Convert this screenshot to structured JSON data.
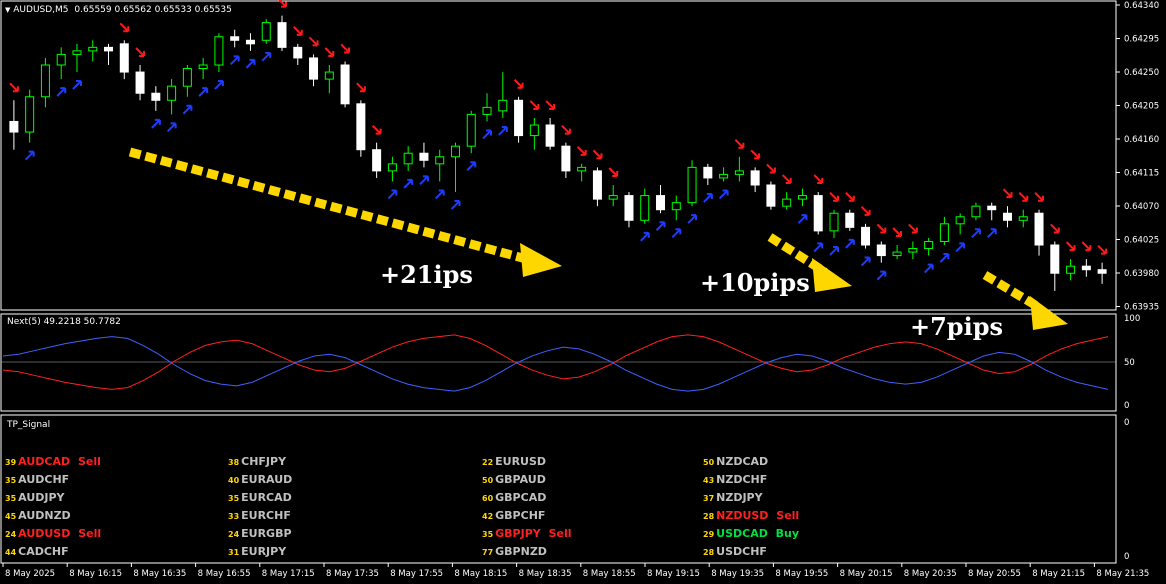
{
  "main_header": {
    "symbol_tf": "AUDUSD,M5",
    "ohlc": "0.65559 0.65562 0.65533 0.65535"
  },
  "price_axis": [
    "0.64340",
    "0.64295",
    "0.64250",
    "0.64205",
    "0.64160",
    "0.64115",
    "0.64070",
    "0.64025",
    "0.63980",
    "0.63935"
  ],
  "indicator": {
    "title": "Next(5) 49.2218 50.7782",
    "levels": [
      "100",
      "50",
      "0"
    ]
  },
  "signal_panel": {
    "title": "TP_Signal",
    "levels": [
      "0",
      "0"
    ]
  },
  "time_axis": [
    "8 May 2025",
    "8 May 16:15",
    "8 May 16:35",
    "8 May 16:55",
    "8 May 17:15",
    "8 May 17:35",
    "8 May 17:55",
    "8 May 18:15",
    "8 May 18:35",
    "8 May 18:55",
    "8 May 19:15",
    "8 May 19:35",
    "8 May 19:55",
    "8 May 20:15",
    "8 May 20:35",
    "8 May 20:55",
    "8 May 21:15",
    "8 May 21:35"
  ],
  "annotations": [
    "+21ips",
    "+10pips",
    "+7pips"
  ],
  "signals": [
    [
      {
        "num": "39",
        "pair": "AUDCAD",
        "signal": "Sell"
      },
      {
        "num": "35",
        "pair": "AUDCHF",
        "signal": ""
      },
      {
        "num": "35",
        "pair": "AUDJPY",
        "signal": ""
      },
      {
        "num": "45",
        "pair": "AUDNZD",
        "signal": ""
      },
      {
        "num": "24",
        "pair": "AUDUSD",
        "signal": "Sell"
      },
      {
        "num": "44",
        "pair": "CADCHF",
        "signal": ""
      }
    ],
    [
      {
        "num": "38",
        "pair": "CHFJPY",
        "signal": ""
      },
      {
        "num": "40",
        "pair": "EURAUD",
        "signal": ""
      },
      {
        "num": "35",
        "pair": "EURCAD",
        "signal": ""
      },
      {
        "num": "33",
        "pair": "EURCHF",
        "signal": ""
      },
      {
        "num": "24",
        "pair": "EURGBP",
        "signal": ""
      },
      {
        "num": "31",
        "pair": "EURJPY",
        "signal": ""
      }
    ],
    [
      {
        "num": "22",
        "pair": "EURUSD",
        "signal": ""
      },
      {
        "num": "50",
        "pair": "GBPAUD",
        "signal": ""
      },
      {
        "num": "60",
        "pair": "GBPCAD",
        "signal": ""
      },
      {
        "num": "42",
        "pair": "GBPCHF",
        "signal": ""
      },
      {
        "num": "35",
        "pair": "GBPJPY",
        "signal": "Sell"
      },
      {
        "num": "77",
        "pair": "GBPNZD",
        "signal": ""
      }
    ],
    [
      {
        "num": "50",
        "pair": "NZDCAD",
        "signal": ""
      },
      {
        "num": "43",
        "pair": "NZDCHF",
        "signal": ""
      },
      {
        "num": "37",
        "pair": "NZDJPY",
        "signal": ""
      },
      {
        "num": "28",
        "pair": "NZDUSD",
        "signal": "Sell"
      },
      {
        "num": "29",
        "pair": "USDCAD",
        "signal": "Buy"
      },
      {
        "num": "28",
        "pair": "USDCHF",
        "signal": ""
      }
    ]
  ],
  "colors": {
    "sell": "#ff2020",
    "buy": "#00e040",
    "bull_candle": "#00ff00",
    "bear_candle": "#ffffff",
    "red_line": "#ff2020",
    "blue_line": "#4060ff",
    "arrow_yellow": "#ffd700"
  },
  "chart_data": {
    "type": "candlestick",
    "candles": [
      [
        0.6418,
        0.6421,
        0.6414,
        0.64165
      ],
      [
        0.64165,
        0.64225,
        0.6415,
        0.64215
      ],
      [
        0.64215,
        0.6427,
        0.642,
        0.6426
      ],
      [
        0.6426,
        0.64285,
        0.6424,
        0.64275
      ],
      [
        0.64275,
        0.6429,
        0.6425,
        0.6428
      ],
      [
        0.6428,
        0.64295,
        0.64265,
        0.64285
      ],
      [
        0.64285,
        0.6429,
        0.6426,
        0.6428
      ],
      [
        0.6429,
        0.64295,
        0.6424,
        0.6425
      ],
      [
        0.6425,
        0.6426,
        0.6421,
        0.6422
      ],
      [
        0.6422,
        0.6423,
        0.64195,
        0.6421
      ],
      [
        0.6421,
        0.6424,
        0.6419,
        0.6423
      ],
      [
        0.6423,
        0.6426,
        0.64215,
        0.64255
      ],
      [
        0.64255,
        0.6427,
        0.6424,
        0.6426
      ],
      [
        0.6426,
        0.64305,
        0.6425,
        0.643
      ],
      [
        0.643,
        0.6431,
        0.64285,
        0.64295
      ],
      [
        0.64295,
        0.64305,
        0.6428,
        0.6429
      ],
      [
        0.64295,
        0.64325,
        0.6429,
        0.6432
      ],
      [
        0.6432,
        0.6433,
        0.6428,
        0.64285
      ],
      [
        0.64285,
        0.6429,
        0.6426,
        0.6427
      ],
      [
        0.6427,
        0.64275,
        0.6423,
        0.6424
      ],
      [
        0.6424,
        0.6426,
        0.6422,
        0.6425
      ],
      [
        0.6426,
        0.64265,
        0.642,
        0.64205
      ],
      [
        0.64205,
        0.6421,
        0.6413,
        0.6414
      ],
      [
        0.6414,
        0.6415,
        0.641,
        0.6411
      ],
      [
        0.6411,
        0.6413,
        0.64095,
        0.6412
      ],
      [
        0.6412,
        0.64145,
        0.6411,
        0.64135
      ],
      [
        0.64135,
        0.6415,
        0.64115,
        0.64125
      ],
      [
        0.6412,
        0.6414,
        0.64095,
        0.6413
      ],
      [
        0.6413,
        0.6415,
        0.6408,
        0.64145
      ],
      [
        0.64145,
        0.64195,
        0.64135,
        0.6419
      ],
      [
        0.6419,
        0.6422,
        0.6418,
        0.642
      ],
      [
        0.64195,
        0.6425,
        0.64185,
        0.6421
      ],
      [
        0.6421,
        0.64215,
        0.6415,
        0.6416
      ],
      [
        0.6416,
        0.64185,
        0.6414,
        0.64175
      ],
      [
        0.64175,
        0.64185,
        0.6414,
        0.64145
      ],
      [
        0.64145,
        0.6415,
        0.641,
        0.6411
      ],
      [
        0.6411,
        0.6412,
        0.64095,
        0.64115
      ],
      [
        0.6411,
        0.64115,
        0.6406,
        0.6407
      ],
      [
        0.6407,
        0.6409,
        0.6406,
        0.64075
      ],
      [
        0.64075,
        0.6408,
        0.6403,
        0.6404
      ],
      [
        0.6404,
        0.64085,
        0.64035,
        0.64075
      ],
      [
        0.64075,
        0.6409,
        0.6405,
        0.64055
      ],
      [
        0.64055,
        0.64075,
        0.6404,
        0.64065
      ],
      [
        0.64065,
        0.64125,
        0.6406,
        0.64115
      ],
      [
        0.64115,
        0.6412,
        0.6409,
        0.641
      ],
      [
        0.641,
        0.64115,
        0.64095,
        0.64105
      ],
      [
        0.64105,
        0.6413,
        0.64095,
        0.6411
      ],
      [
        0.6411,
        0.64115,
        0.6408,
        0.6409
      ],
      [
        0.6409,
        0.64095,
        0.64055,
        0.6406
      ],
      [
        0.6406,
        0.6408,
        0.64055,
        0.6407
      ],
      [
        0.6407,
        0.64085,
        0.6406,
        0.64075
      ],
      [
        0.64075,
        0.6408,
        0.6402,
        0.64025
      ],
      [
        0.64025,
        0.64055,
        0.64015,
        0.6405
      ],
      [
        0.6405,
        0.64055,
        0.64025,
        0.6403
      ],
      [
        0.6403,
        0.64035,
        0.64,
        0.64005
      ],
      [
        0.64005,
        0.6401,
        0.6398,
        0.6399
      ],
      [
        0.6399,
        0.64005,
        0.63985,
        0.63995
      ],
      [
        0.63995,
        0.6401,
        0.63985,
        0.64
      ],
      [
        0.64,
        0.64015,
        0.6399,
        0.6401
      ],
      [
        0.6401,
        0.64045,
        0.64005,
        0.64035
      ],
      [
        0.64035,
        0.6405,
        0.6402,
        0.64045
      ],
      [
        0.64045,
        0.64065,
        0.6404,
        0.6406
      ],
      [
        0.6406,
        0.64065,
        0.6404,
        0.64055
      ],
      [
        0.6405,
        0.6406,
        0.6403,
        0.6404
      ],
      [
        0.6404,
        0.64055,
        0.6403,
        0.64045
      ],
      [
        0.6405,
        0.64055,
        0.6399,
        0.64005
      ],
      [
        0.64005,
        0.6401,
        0.6394,
        0.63965
      ],
      [
        0.63965,
        0.63985,
        0.63955,
        0.63975
      ],
      [
        0.63975,
        0.63985,
        0.6396,
        0.6397
      ],
      [
        0.6397,
        0.6398,
        0.6395,
        0.63965
      ]
    ],
    "up_arrow_idx": [
      1,
      3,
      4,
      9,
      10,
      11,
      12,
      13,
      14,
      15,
      16,
      24,
      25,
      26,
      27,
      28,
      29,
      30,
      31,
      40,
      41,
      42,
      43,
      44,
      45,
      50,
      51,
      52,
      53,
      54,
      55,
      58,
      59,
      60,
      61,
      62
    ],
    "down_arrow_idx": [
      0,
      7,
      8,
      17,
      18,
      19,
      20,
      21,
      22,
      23,
      32,
      33,
      34,
      35,
      36,
      37,
      38,
      46,
      47,
      48,
      49,
      51,
      52,
      53,
      54,
      55,
      56,
      57,
      63,
      64,
      65,
      66,
      67,
      68,
      69
    ],
    "indicator_red": [
      42,
      40,
      36,
      32,
      28,
      25,
      22,
      20,
      22,
      30,
      40,
      52,
      62,
      70,
      74,
      76,
      72,
      64,
      56,
      48,
      42,
      40,
      44,
      52,
      60,
      68,
      74,
      78,
      80,
      82,
      78,
      70,
      60,
      50,
      42,
      36,
      32,
      34,
      40,
      48,
      58,
      66,
      74,
      80,
      82,
      80,
      74,
      66,
      58,
      50,
      44,
      40,
      42,
      48,
      56,
      62,
      68,
      72,
      74,
      72,
      66,
      58,
      50,
      42,
      38,
      40,
      48,
      58,
      66,
      72,
      76,
      80
    ],
    "indicator_blue": [
      58,
      60,
      64,
      68,
      72,
      75,
      78,
      80,
      78,
      70,
      60,
      48,
      38,
      30,
      26,
      24,
      28,
      36,
      44,
      52,
      58,
      60,
      56,
      48,
      40,
      32,
      26,
      22,
      20,
      18,
      22,
      30,
      40,
      50,
      58,
      64,
      68,
      66,
      60,
      52,
      42,
      34,
      26,
      20,
      18,
      20,
      26,
      34,
      42,
      50,
      56,
      60,
      58,
      52,
      44,
      38,
      32,
      28,
      26,
      28,
      34,
      42,
      50,
      58,
      62,
      60,
      52,
      42,
      34,
      28,
      24,
      20
    ],
    "indicator_ylim": [
      0,
      100
    ],
    "price_ylim": [
      0.6392,
      0.64345
    ]
  }
}
